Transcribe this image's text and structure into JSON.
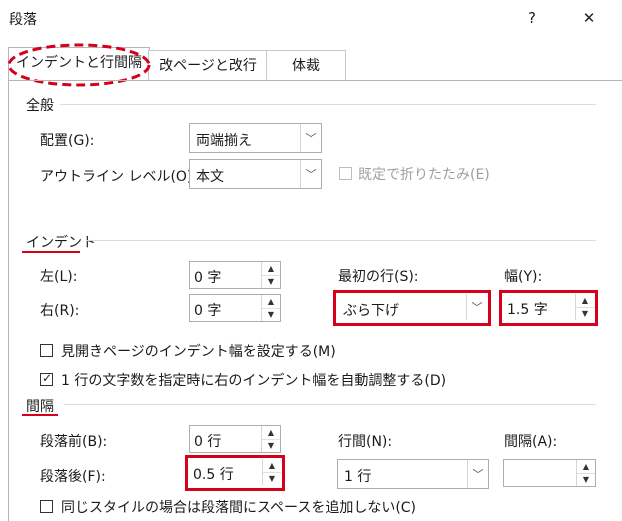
{
  "window": {
    "title": "段落",
    "help_label": "?",
    "close_label": "✕"
  },
  "tabs": [
    {
      "label": "インデントと行間隔"
    },
    {
      "label": "改ページと改行"
    },
    {
      "label": "体裁"
    }
  ],
  "general": {
    "heading": "全般",
    "alignment_label": "配置(G):",
    "alignment_value": "両端揃え",
    "outline_label": "アウトライン レベル(O):",
    "outline_value": "本文",
    "collapsed_default_label": "既定で折りたたみ(E)"
  },
  "indent": {
    "heading": "インデント",
    "left_label": "左(L):",
    "left_value": "0 字",
    "right_label": "右(R):",
    "right_value": "0 字",
    "first_line_label": "最初の行(S):",
    "first_line_value": "ぶら下げ",
    "by_label": "幅(Y):",
    "by_value": "1.5 字",
    "mirror_label": "見開きページのインデント幅を設定する(M)",
    "mirror_checked": false,
    "auto_adjust_label": "1 行の文字数を指定時に右のインデント幅を自動調整する(D)",
    "auto_adjust_checked": true
  },
  "spacing": {
    "heading": "間隔",
    "before_label": "段落前(B):",
    "before_value": "0 行",
    "after_label": "段落後(F):",
    "after_value": "0.5 行",
    "line_spacing_label": "行間(N):",
    "line_spacing_value": "1 行",
    "at_label": "間隔(A):",
    "at_value": "",
    "no_space_label": "同じスタイルの場合は段落間にスペースを追加しない(C)",
    "no_space_checked": false
  },
  "colors": {
    "highlight": "#d6001c"
  }
}
